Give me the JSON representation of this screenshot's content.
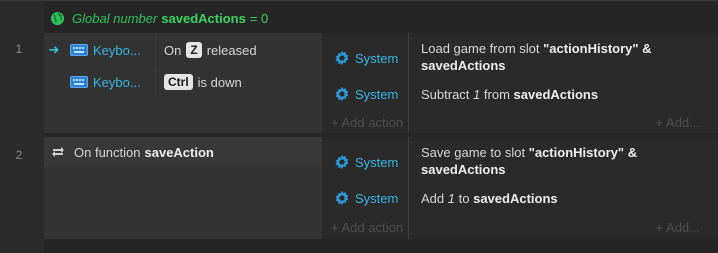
{
  "global_var": {
    "prefix": "Global number",
    "name": "savedActions",
    "value": "= 0",
    "icon": "globe-icon"
  },
  "events": [
    {
      "number": "1",
      "conditions": [
        {
          "object": "Keybo...",
          "text_before": "On",
          "key": "Z",
          "text_after": "released",
          "trigger": true
        },
        {
          "object": "Keybo...",
          "text_before": "",
          "key": "Ctrl",
          "text_after": "is down",
          "trigger": false
        }
      ],
      "actions": [
        {
          "object": "System",
          "text_before": "Load game from slot",
          "bold1": "\"actionHistory\" & savedActions",
          "italic": "",
          "text_mid": "",
          "bold2": ""
        },
        {
          "object": "System",
          "text_before": "Subtract",
          "italic": "1",
          "text_mid": "from",
          "bold2": "savedActions"
        }
      ],
      "add_action": "+ Add action",
      "add_more": "+ Add..."
    },
    {
      "number": "2",
      "function": {
        "label": "On function",
        "name": "saveAction"
      },
      "actions": [
        {
          "object": "System",
          "text_before": "Save game to slot",
          "bold1": "\"actionHistory\" & savedActions"
        },
        {
          "object": "System",
          "text_before": "Add",
          "italic": "1",
          "text_mid": "to",
          "bold2": "savedActions"
        }
      ],
      "add_action": "+ Add action",
      "add_more": "+ Add..."
    }
  ],
  "colors": {
    "accent_object": "#35b5e5",
    "global": "#39d35f",
    "background": "#262626"
  }
}
